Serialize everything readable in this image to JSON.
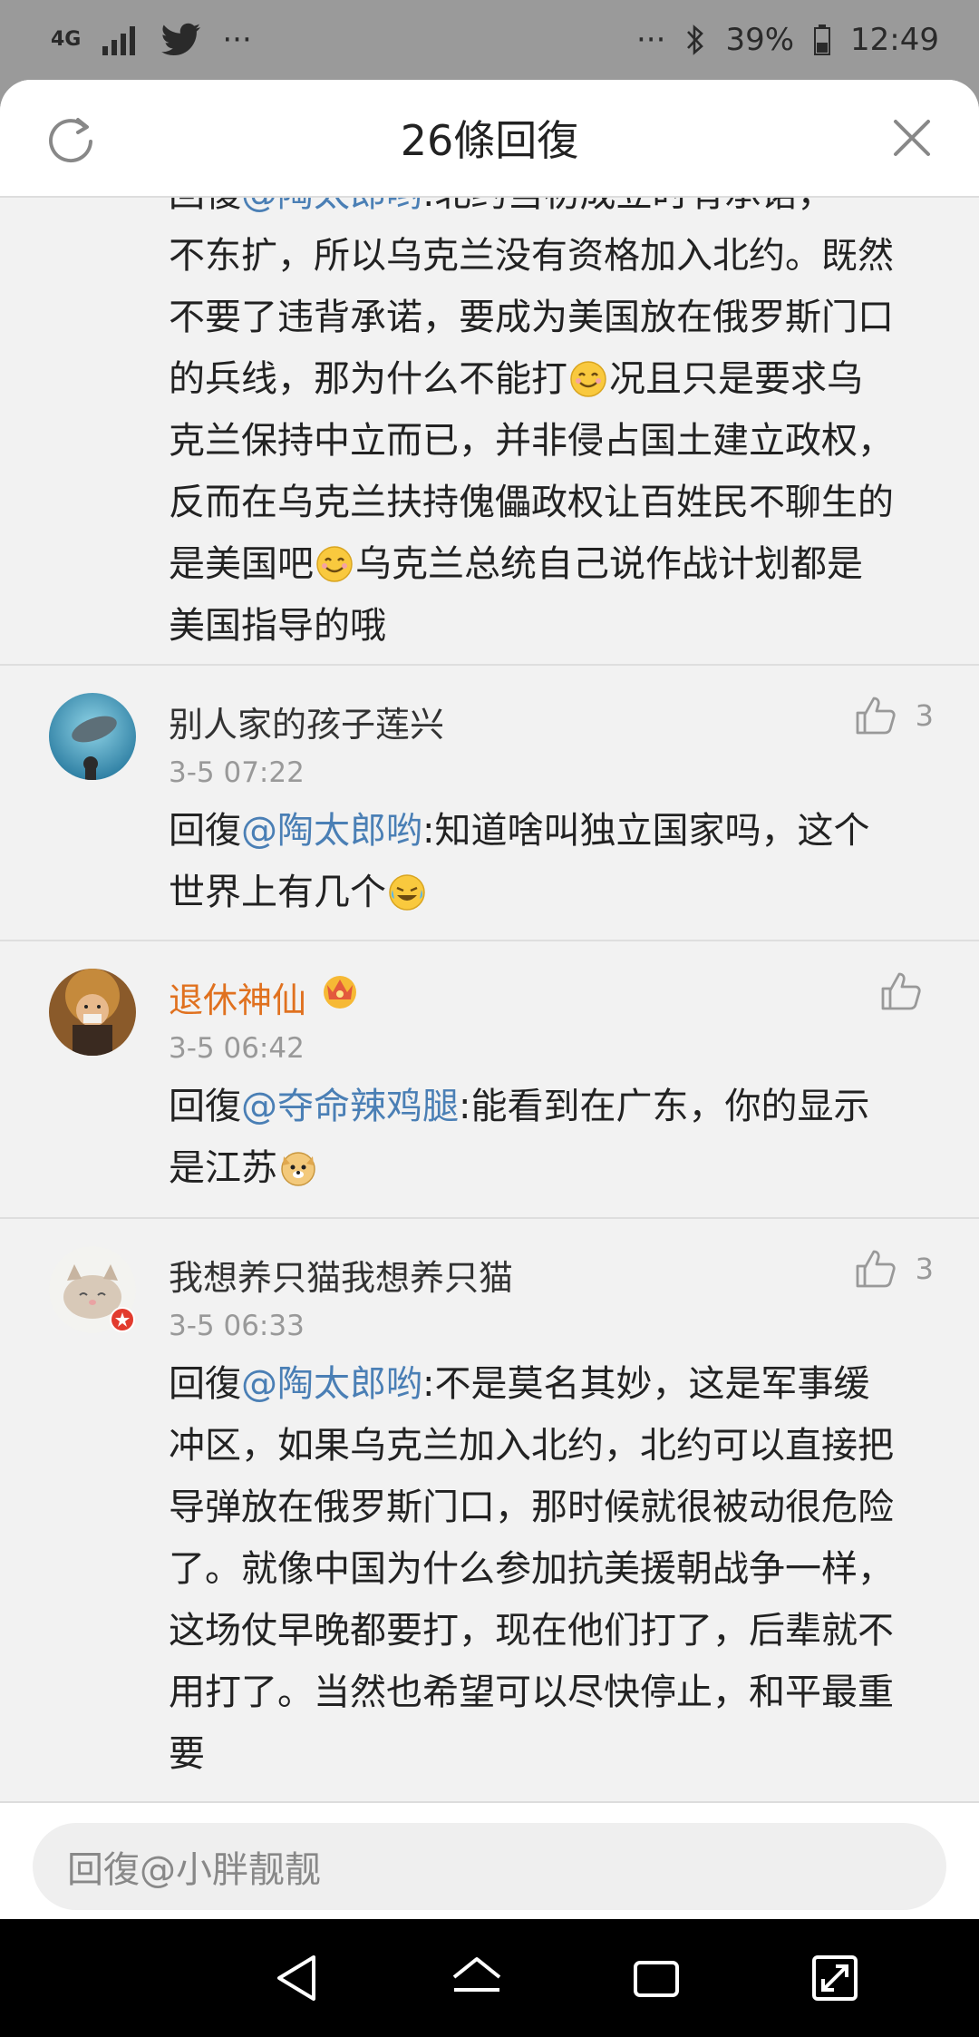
{
  "status_bar": {
    "network": "4G",
    "twitter_icon": "twitter-icon",
    "more": "···",
    "overflow": "···",
    "battery": "39%",
    "time": "12:49"
  },
  "header": {
    "title": "26條回復"
  },
  "partial_comment": {
    "line0_prefix": "回復",
    "line0_mention": "@陶太郎哟",
    "line0_rest": ":北约当初成立时有承诺，",
    "line1": "不东扩，所以乌克兰没有资格加入北约。既然",
    "line2": "不要了违背承诺，要成为美国放在俄罗斯门口",
    "line3a": "的兵线，那为什么不能打",
    "line3b": "况且只是要求乌",
    "line4": "克兰保持中立而已，并非侵占国土建立政权，",
    "line5": "反而在乌克兰扶持傀儡政权让百姓民不聊生的",
    "line6a": "是美国吧",
    "line6b": "乌克兰总统自己说作战计划都是",
    "line7": "美国指导的哦"
  },
  "comments": [
    {
      "name": "别人家的孩子莲兴",
      "time": "3-5 07:22",
      "likes": "3",
      "reply_prefix": "回復",
      "mention": "@陶太郎哟",
      "text_a": ":知道啥叫独立国家吗，这个",
      "text_b": "世界上有几个"
    },
    {
      "name": "退休神仙",
      "time": "3-5 06:42",
      "likes": "",
      "reply_prefix": "回復",
      "mention": "@夺命辣鸡腿",
      "text_a": ":能看到在广东，你的显示",
      "text_b": "是江苏"
    },
    {
      "name": "我想养只猫我想养只猫",
      "time": "3-5 06:33",
      "likes": "3",
      "reply_prefix": "回復",
      "mention": "@陶太郎哟",
      "text_a": ":不是莫名其妙，这是军事缓",
      "lines": [
        "冲区，如果乌克兰加入北约，北约可以直接把",
        "导弹放在俄罗斯门口，那时候就很被动很危险",
        "了。就像中国为什么参加抗美援朝战争一样，",
        "这场仗早晚都要打，现在他们打了，后辈就不",
        "用打了。当然也希望可以尽快停止，和平最重",
        "要"
      ]
    }
  ],
  "reply_bar": {
    "placeholder": "回復@小胖靓靓"
  },
  "colors": {
    "mention": "#4a7fb5",
    "vip_name": "#e0711f",
    "background": "#f2f2f2"
  }
}
